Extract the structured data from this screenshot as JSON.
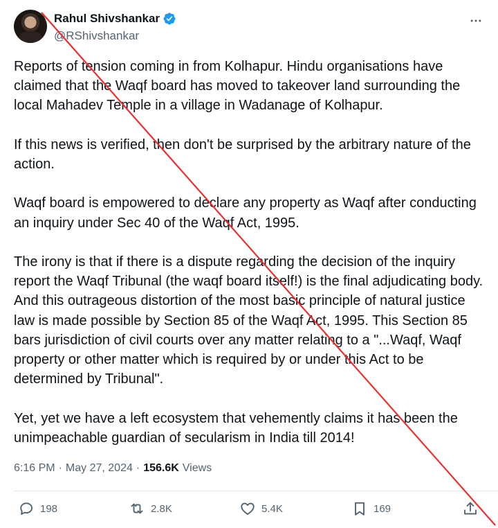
{
  "author": {
    "name": "Rahul Shivshankar",
    "handle": "@RShivshankar",
    "verified_color": "#1d9bf0"
  },
  "tweet": {
    "text": "Reports of tension coming in from Kolhapur. Hindu organisations have claimed that the Waqf board has moved to takeover land surrounding the local Mahadev Temple in a village in Wadanage of Kolhapur.\n\nIf this news is verified, then don't be surprised by the arbitrary nature of the action.\n\nWaqf board is empowered to declare any property as Waqf after conducting an inquiry under Sec 40 of the Waqf Act, 1995.\n\nThe irony is that if there is a dispute regarding the decision of the inquiry report the Waqf Tribunal (the waqf board itself!) is the final adjudicating body. And this outrageous distortion of the most basic principle of natural justice law is made possible by Section 85 of the Waqf Act, 1995. This Section 85 bars jurisdiction of civil courts over any matter relating to a \"...Waqf, Waqf property or other matter which is required by or under this Act to be determined by Tribunal\".\n\nYet, yet we have a left ecosystem that vehemently claims it has been the unimpeachable guardian of secularism in India till 2014!"
  },
  "meta": {
    "time": "6:16 PM",
    "separator": "·",
    "date": "May 27, 2024",
    "views_count": "156.6K",
    "views_label": "Views"
  },
  "actions": {
    "replies": "198",
    "reposts": "2.8K",
    "likes": "5.4K",
    "bookmarks": "169"
  },
  "icons": {
    "more": "more-horizontal-icon",
    "reply": "reply-icon",
    "repost": "repost-icon",
    "like": "heart-icon",
    "bookmark": "bookmark-icon",
    "share": "share-icon"
  },
  "overlay": {
    "strike_color": "#e8312f"
  }
}
